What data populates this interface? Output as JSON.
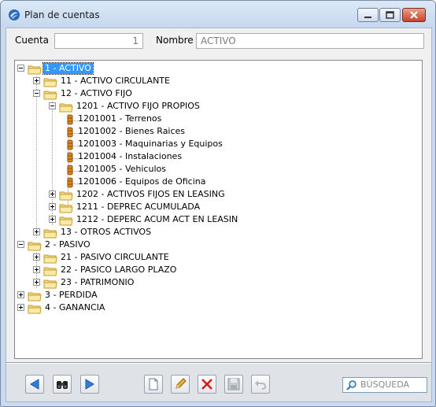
{
  "window": {
    "title": "Plan de cuentas"
  },
  "form": {
    "cuenta_label": "Cuenta",
    "cuenta_value": "1",
    "nombre_label": "Nombre",
    "nombre_value": "ACTIVO"
  },
  "tree": [
    {
      "label": "1 - ACTIVO",
      "type": "folder",
      "expanded": true,
      "selected": true
    },
    {
      "label": "11 - ACTIVO CIRCULANTE",
      "type": "folder",
      "expanded": false
    },
    {
      "label": "12 - ACTIVO FIJO",
      "type": "folder",
      "expanded": true
    },
    {
      "label": "1201 - ACTIVO FIJO PROPIOS",
      "type": "folder",
      "expanded": true
    },
    {
      "label": "1201001 - Terrenos",
      "type": "leaf"
    },
    {
      "label": "1201002 - Bienes Raices",
      "type": "leaf"
    },
    {
      "label": "1201003 - Maquinarias y Equipos",
      "type": "leaf"
    },
    {
      "label": "1201004 - Instalaciones",
      "type": "leaf"
    },
    {
      "label": "1201005 - Vehiculos",
      "type": "leaf"
    },
    {
      "label": "1201006 - Equipos de Oficina",
      "type": "leaf"
    },
    {
      "label": "1202 - ACTIVOS FIJOS EN LEASING",
      "type": "folder",
      "expanded": false
    },
    {
      "label": "1211 - DEPREC ACUMULADA",
      "type": "folder",
      "expanded": false
    },
    {
      "label": "1212 - DEPERC ACUM ACT EN LEASIN",
      "type": "folder",
      "expanded": false
    },
    {
      "label": "13 - OTROS ACTIVOS",
      "type": "folder",
      "expanded": false
    },
    {
      "label": "2 - PASIVO",
      "type": "folder",
      "expanded": true
    },
    {
      "label": "21 - PASIVO CIRCULANTE",
      "type": "folder",
      "expanded": false
    },
    {
      "label": "22 - PASICO LARGO PLAZO",
      "type": "folder",
      "expanded": false
    },
    {
      "label": "23 - PATRIMONIO",
      "type": "folder",
      "expanded": false
    },
    {
      "label": "3 - PERDIDA",
      "type": "folder",
      "expanded": false
    },
    {
      "label": "4 - GANANCIA",
      "type": "folder",
      "expanded": false
    }
  ],
  "toolbar": {
    "buttons": [
      "arrow-left-icon",
      "binoculars-icon",
      "arrow-right-icon",
      "new-document-icon",
      "pencil-icon",
      "delete-x-icon",
      "save-disk-icon",
      "undo-icon"
    ],
    "search_placeholder": "BÚSQUEDA"
  },
  "colors": {
    "selection": "#3399ff",
    "title_bg": "#c6d8ef",
    "close_button": "#c9432b"
  }
}
